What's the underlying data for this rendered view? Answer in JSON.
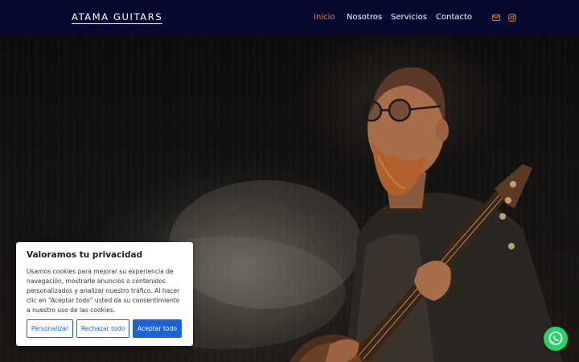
{
  "header": {
    "logo": "ATAMA GUITARS",
    "nav": [
      {
        "label": "Inicio",
        "active": true
      },
      {
        "label": "Nosotros",
        "active": false
      },
      {
        "label": "Servicios",
        "active": false
      },
      {
        "label": "Contacto",
        "active": false
      }
    ],
    "icons": [
      "envelope-icon",
      "instagram-icon"
    ]
  },
  "colors": {
    "nav_bg": "#070a2e",
    "accent": "#e0872e",
    "cookie_button": "#1863dc",
    "whatsapp": "#25d366"
  },
  "cookie_banner": {
    "title": "Valoramos tu privacidad",
    "text": "Usamos cookies para mejorar su experiencia de navegación, mostrarle anuncios o contenidos personalizados y analizar nuestro tráfico. Al hacer clic en “Aceptar todo” usted da su consentimiento a nuestro uso de las cookies.",
    "buttons": {
      "customize": "Personalizar",
      "reject": "Rechazar todo",
      "accept": "Aceptar todo"
    }
  },
  "floating": {
    "icon": "whatsapp-icon"
  }
}
